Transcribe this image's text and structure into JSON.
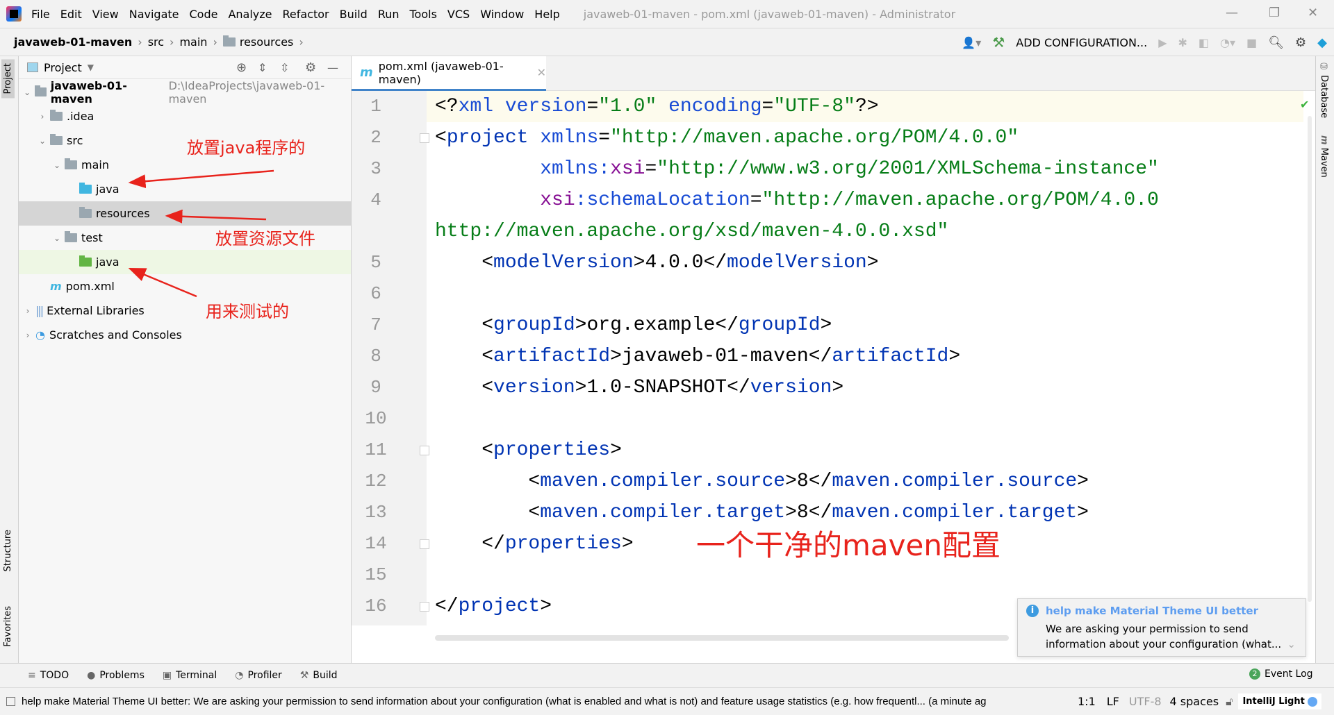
{
  "menu": [
    "File",
    "Edit",
    "View",
    "Navigate",
    "Code",
    "Analyze",
    "Refactor",
    "Build",
    "Run",
    "Tools",
    "VCS",
    "Window",
    "Help"
  ],
  "window_title": "javaweb-01-maven - pom.xml (javaweb-01-maven) - Administrator",
  "breadcrumb": [
    "javaweb-01-maven",
    "src",
    "main",
    "resources"
  ],
  "toolbar": {
    "add_config": "ADD CONFIGURATION..."
  },
  "left_stripe": {
    "project": "Project",
    "structure": "Structure",
    "favorites": "Favorites"
  },
  "right_stripe": {
    "database": "Database",
    "maven": "Maven"
  },
  "project_panel": {
    "title": "Project",
    "tree": [
      {
        "label": "javaweb-01-maven",
        "extra": "D:\\IdeaProjects\\javaweb-01-maven",
        "level": 0,
        "chev": "v",
        "icon": "module"
      },
      {
        "label": ".idea",
        "level": 1,
        "chev": ">",
        "icon": "folder"
      },
      {
        "label": "src",
        "level": 1,
        "chev": "v",
        "icon": "folder"
      },
      {
        "label": "main",
        "level": 2,
        "chev": "v",
        "icon": "folder"
      },
      {
        "label": "java",
        "level": 3,
        "chev": "",
        "icon": "blue"
      },
      {
        "label": "resources",
        "level": 3,
        "chev": "",
        "icon": "res",
        "state": "sel"
      },
      {
        "label": "test",
        "level": 2,
        "chev": "v",
        "icon": "folder"
      },
      {
        "label": "java",
        "level": 3,
        "chev": "",
        "icon": "green",
        "state": "hl"
      },
      {
        "label": "pom.xml",
        "level": 1,
        "chev": "",
        "icon": "maven"
      },
      {
        "label": "External Libraries",
        "level": 0,
        "chev": ">",
        "icon": "lib"
      },
      {
        "label": "Scratches and Consoles",
        "level": 0,
        "chev": ">",
        "icon": "scratch"
      }
    ]
  },
  "editor": {
    "tab": "pom.xml (javaweb-01-maven)",
    "lines": [
      [
        [
          "t-txt",
          "<?"
        ],
        [
          "t-attr",
          "xml "
        ],
        [
          "t-attr",
          "version"
        ],
        [
          "t-txt",
          "="
        ],
        [
          "t-val",
          "\"1.0\" "
        ],
        [
          "t-attr",
          "encoding"
        ],
        [
          "t-txt",
          "="
        ],
        [
          "t-val",
          "\"UTF-8\""
        ],
        [
          "t-txt",
          "?>"
        ]
      ],
      [
        [
          "t-txt",
          "<"
        ],
        [
          "t-tag",
          "project "
        ],
        [
          "t-attr",
          "xmlns"
        ],
        [
          "t-txt",
          "="
        ],
        [
          "t-val",
          "\"http://maven.apache.org/POM/4.0.0\""
        ]
      ],
      [
        [
          "t-txt",
          "         "
        ],
        [
          "t-attr",
          "xmlns:"
        ],
        [
          "t-ns",
          "xsi"
        ],
        [
          "t-txt",
          "="
        ],
        [
          "t-val",
          "\"http://www.w3.org/2001/XMLSchema-instance\""
        ]
      ],
      [
        [
          "t-txt",
          "         "
        ],
        [
          "t-ns",
          "xsi"
        ],
        [
          "t-attr",
          ":schemaLocation"
        ],
        [
          "t-txt",
          "="
        ],
        [
          "t-val",
          "\"http://maven.apache.org/POM/4.0.0 http://maven.apache.org/xsd/maven-4.0.0.xsd\""
        ]
      ],
      [
        [
          "t-txt",
          "    <"
        ],
        [
          "t-tag",
          "modelVersion"
        ],
        [
          "t-txt",
          ">4.0.0</"
        ],
        [
          "t-tag",
          "modelVersion"
        ],
        [
          "t-txt",
          ">"
        ]
      ],
      [],
      [
        [
          "t-txt",
          "    <"
        ],
        [
          "t-tag",
          "groupId"
        ],
        [
          "t-txt",
          ">org.example</"
        ],
        [
          "t-tag",
          "groupId"
        ],
        [
          "t-txt",
          ">"
        ]
      ],
      [
        [
          "t-txt",
          "    <"
        ],
        [
          "t-tag",
          "artifactId"
        ],
        [
          "t-txt",
          ">javaweb-01-maven</"
        ],
        [
          "t-tag",
          "artifactId"
        ],
        [
          "t-txt",
          ">"
        ]
      ],
      [
        [
          "t-txt",
          "    <"
        ],
        [
          "t-tag",
          "version"
        ],
        [
          "t-txt",
          ">1.0-SNAPSHOT</"
        ],
        [
          "t-tag",
          "version"
        ],
        [
          "t-txt",
          ">"
        ]
      ],
      [],
      [
        [
          "t-txt",
          "    <"
        ],
        [
          "t-tag",
          "properties"
        ],
        [
          "t-txt",
          ">"
        ]
      ],
      [
        [
          "t-txt",
          "        <"
        ],
        [
          "t-tag",
          "maven.compiler.source"
        ],
        [
          "t-txt",
          ">8</"
        ],
        [
          "t-tag",
          "maven.compiler.source"
        ],
        [
          "t-txt",
          ">"
        ]
      ],
      [
        [
          "t-txt",
          "        <"
        ],
        [
          "t-tag",
          "maven.compiler.target"
        ],
        [
          "t-txt",
          ">8</"
        ],
        [
          "t-tag",
          "maven.compiler.target"
        ],
        [
          "t-txt",
          ">"
        ]
      ],
      [
        [
          "t-txt",
          "    </"
        ],
        [
          "t-tag",
          "properties"
        ],
        [
          "t-txt",
          ">"
        ]
      ],
      [],
      [
        [
          "t-txt",
          "</"
        ],
        [
          "t-tag",
          "project"
        ],
        [
          "t-txt",
          ">"
        ]
      ]
    ]
  },
  "annotations": {
    "java": "放置java程序的",
    "resources": "放置资源文件",
    "test": "用来测试的",
    "clean": "一个干净的maven配置"
  },
  "notification": {
    "title": "help make Material Theme UI better",
    "body1": "We are asking your permission to send",
    "body2": "information about your configuration (what..."
  },
  "bottom_tools": [
    "TODO",
    "Problems",
    "Terminal",
    "Profiler",
    "Build"
  ],
  "event_log": {
    "label": "Event Log",
    "count": "2"
  },
  "status": {
    "message": "help make Material Theme UI better: We are asking your permission to send information about your configuration (what is enabled and what is not) and feature usage statistics (e.g. how frequentl... (a minute ag",
    "position": "1:1",
    "line_sep": "LF",
    "encoding": "UTF-8",
    "indent": "4 spaces",
    "theme": "IntelliJ Light"
  },
  "colors": {
    "accent": "#4083c9",
    "annotation": "#e8231c"
  }
}
